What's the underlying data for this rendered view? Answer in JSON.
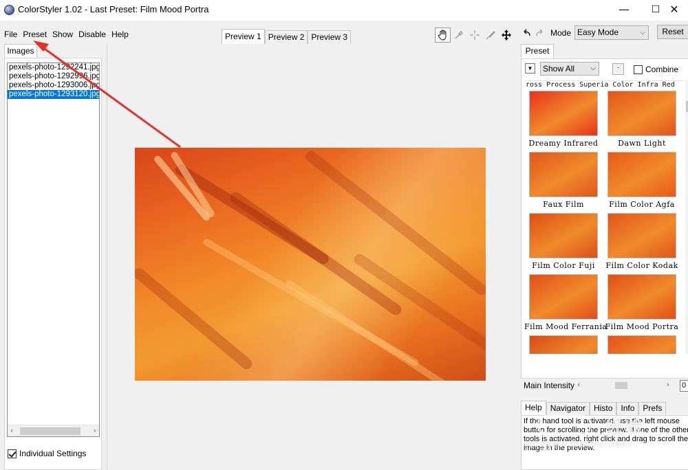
{
  "window": {
    "title": "ColorStyler 1.02 - Last Preset: Film Mood Portra",
    "minimize": "—",
    "maximize": "☐",
    "close": "✕"
  },
  "menu": [
    "File",
    "Preset",
    "Show",
    "Disable",
    "Help"
  ],
  "preview_tabs": {
    "items": [
      "Preview 1",
      "Preview 2",
      "Preview 3"
    ],
    "active": 0
  },
  "toolbar": {
    "icons": [
      "hand-icon",
      "eyedropper-icon",
      "crosshair-icon",
      "brush-icon",
      "move-icon"
    ],
    "undo": "↶",
    "redo": "↷",
    "mode_label": "Mode",
    "mode_value": "Easy Mode",
    "reset_label": "Reset"
  },
  "images_panel": {
    "tab_label": "Images",
    "files": [
      "pexels-photo-1292241.jpg",
      "pexels-photo-1292996.jpg",
      "pexels-photo-1293006.jpg",
      "pexels-photo-1293120.jpg"
    ],
    "selected_index": 3,
    "individual_settings_label": "Individual Settings",
    "individual_settings_checked": true
  },
  "preset_panel": {
    "tab_label": "Preset",
    "filter_value": "Show All",
    "dot_label": "·",
    "combine_label": "Combine",
    "combine_checked": false,
    "cutoff_row_text": "ross Process Superia Color Infra Red",
    "presets": [
      {
        "name": "Dreamy Infrared",
        "color": "#e8321c"
      },
      {
        "name": "Dawn Light",
        "color": "#e2561a"
      },
      {
        "name": "Faux Film",
        "color": "#e0551c"
      },
      {
        "name": "Film Color Agfa",
        "color": "#e85a16"
      },
      {
        "name": "Film Color Fuji",
        "color": "#dc4f17"
      },
      {
        "name": "Film Color Kodak",
        "color": "#e0561a"
      },
      {
        "name": "Film Mood Ferrania",
        "color": "#e24e18"
      },
      {
        "name": "Film Mood Portra",
        "color": "#e04f17"
      },
      {
        "name": "",
        "color": "#d94a16"
      },
      {
        "name": "",
        "color": "#e5521a"
      }
    ],
    "intensity_label": "Main Intensity",
    "intensity_value": "0"
  },
  "info_panel": {
    "tabs": [
      "Help",
      "Navigator",
      "Histo",
      "Info",
      "Prefs"
    ],
    "active": 0,
    "help_text": "If the hand tool is activated, use the left mouse button for scrolling the preview. If one of the other tools is activated, right click and drag to scroll the image in the preview."
  },
  "watermark": {
    "brand": "经验",
    "url": "jingyan.baidu.com"
  },
  "colors": {
    "annotation_arrow": "#e8302a",
    "selection": "#0078d7",
    "preview_primary": "#ec6a1f"
  }
}
